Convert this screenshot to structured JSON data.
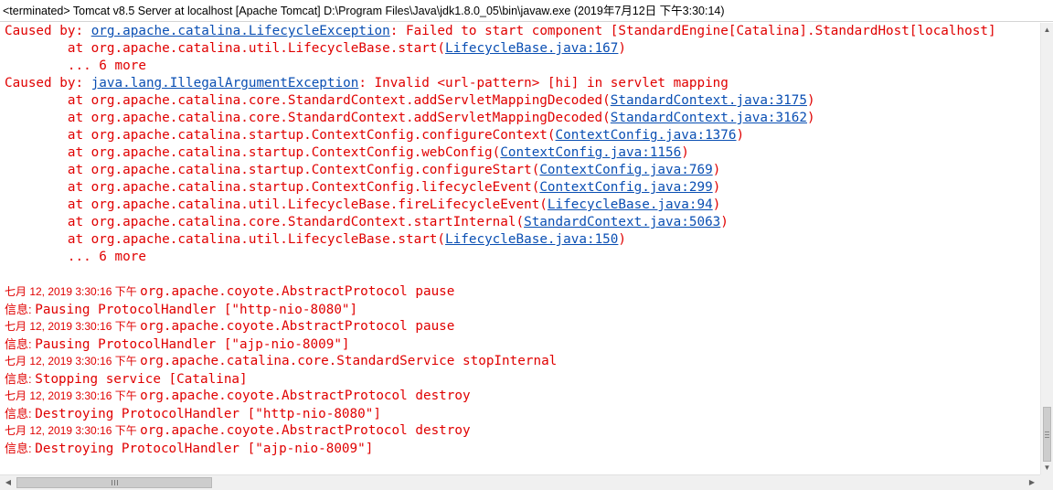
{
  "window": {
    "title": "<terminated> Tomcat v8.5 Server at localhost [Apache Tomcat] D:\\Program Files\\Java\\jdk1.8.0_05\\bin\\javaw.exe (2019年7月12日 下午3:30:14)"
  },
  "colors": {
    "error_text": "#e00000",
    "link": "#0a4fb3"
  },
  "console": {
    "lines": [
      {
        "segs": [
          {
            "t": "Caused by: "
          },
          {
            "t": "org.apache.catalina.LifecycleException",
            "link": true
          },
          {
            "t": ": Failed to start component [StandardEngine[Catalina].StandardHost[localhost]"
          }
        ]
      },
      {
        "segs": [
          {
            "t": "        at org.apache.catalina.util.LifecycleBase.start("
          },
          {
            "t": "LifecycleBase.java:167",
            "link": true
          },
          {
            "t": ")"
          }
        ]
      },
      {
        "segs": [
          {
            "t": "        ... 6 more"
          }
        ]
      },
      {
        "segs": [
          {
            "t": "Caused by: "
          },
          {
            "t": "java.lang.IllegalArgumentException",
            "link": true
          },
          {
            "t": ": Invalid <url-pattern> [hi] in servlet mapping"
          }
        ]
      },
      {
        "segs": [
          {
            "t": "        at org.apache.catalina.core.StandardContext.addServletMappingDecoded("
          },
          {
            "t": "StandardContext.java:3175",
            "link": true
          },
          {
            "t": ")"
          }
        ]
      },
      {
        "segs": [
          {
            "t": "        at org.apache.catalina.core.StandardContext.addServletMappingDecoded("
          },
          {
            "t": "StandardContext.java:3162",
            "link": true
          },
          {
            "t": ")"
          }
        ]
      },
      {
        "segs": [
          {
            "t": "        at org.apache.catalina.startup.ContextConfig.configureContext("
          },
          {
            "t": "ContextConfig.java:1376",
            "link": true
          },
          {
            "t": ")"
          }
        ]
      },
      {
        "segs": [
          {
            "t": "        at org.apache.catalina.startup.ContextConfig.webConfig("
          },
          {
            "t": "ContextConfig.java:1156",
            "link": true
          },
          {
            "t": ")"
          }
        ]
      },
      {
        "segs": [
          {
            "t": "        at org.apache.catalina.startup.ContextConfig.configureStart("
          },
          {
            "t": "ContextConfig.java:769",
            "link": true
          },
          {
            "t": ")"
          }
        ]
      },
      {
        "segs": [
          {
            "t": "        at org.apache.catalina.startup.ContextConfig.lifecycleEvent("
          },
          {
            "t": "ContextConfig.java:299",
            "link": true
          },
          {
            "t": ")"
          }
        ]
      },
      {
        "segs": [
          {
            "t": "        at org.apache.catalina.util.LifecycleBase.fireLifecycleEvent("
          },
          {
            "t": "LifecycleBase.java:94",
            "link": true
          },
          {
            "t": ")"
          }
        ]
      },
      {
        "segs": [
          {
            "t": "        at org.apache.catalina.core.StandardContext.startInternal("
          },
          {
            "t": "StandardContext.java:5063",
            "link": true
          },
          {
            "t": ")"
          }
        ]
      },
      {
        "segs": [
          {
            "t": "        at org.apache.catalina.util.LifecycleBase.start("
          },
          {
            "t": "LifecycleBase.java:150",
            "link": true
          },
          {
            "t": ")"
          }
        ]
      },
      {
        "segs": [
          {
            "t": "        ... 6 more"
          }
        ]
      },
      {
        "segs": []
      },
      {
        "segs": [
          {
            "t": "七月 12, 2019 3:30:16 下午 ",
            "cls": "date"
          },
          {
            "t": "org.apache.coyote.AbstractProtocol pause"
          }
        ]
      },
      {
        "segs": [
          {
            "t": "信息: ",
            "cls": "lvl"
          },
          {
            "t": "Pausing ProtocolHandler [\"http-nio-8080\"]"
          }
        ]
      },
      {
        "segs": [
          {
            "t": "七月 12, 2019 3:30:16 下午 ",
            "cls": "date"
          },
          {
            "t": "org.apache.coyote.AbstractProtocol pause"
          }
        ]
      },
      {
        "segs": [
          {
            "t": "信息: ",
            "cls": "lvl"
          },
          {
            "t": "Pausing ProtocolHandler [\"ajp-nio-8009\"]"
          }
        ]
      },
      {
        "segs": [
          {
            "t": "七月 12, 2019 3:30:16 下午 ",
            "cls": "date"
          },
          {
            "t": "org.apache.catalina.core.StandardService stopInternal"
          }
        ]
      },
      {
        "segs": [
          {
            "t": "信息: ",
            "cls": "lvl"
          },
          {
            "t": "Stopping service [Catalina]"
          }
        ]
      },
      {
        "segs": [
          {
            "t": "七月 12, 2019 3:30:16 下午 ",
            "cls": "date"
          },
          {
            "t": "org.apache.coyote.AbstractProtocol destroy"
          }
        ]
      },
      {
        "segs": [
          {
            "t": "信息: ",
            "cls": "lvl"
          },
          {
            "t": "Destroying ProtocolHandler [\"http-nio-8080\"]"
          }
        ]
      },
      {
        "segs": [
          {
            "t": "七月 12, 2019 3:30:16 下午 ",
            "cls": "date"
          },
          {
            "t": "org.apache.coyote.AbstractProtocol destroy"
          }
        ]
      },
      {
        "segs": [
          {
            "t": "信息: ",
            "cls": "lvl"
          },
          {
            "t": "Destroying ProtocolHandler [\"ajp-nio-8009\"]"
          }
        ]
      }
    ]
  }
}
